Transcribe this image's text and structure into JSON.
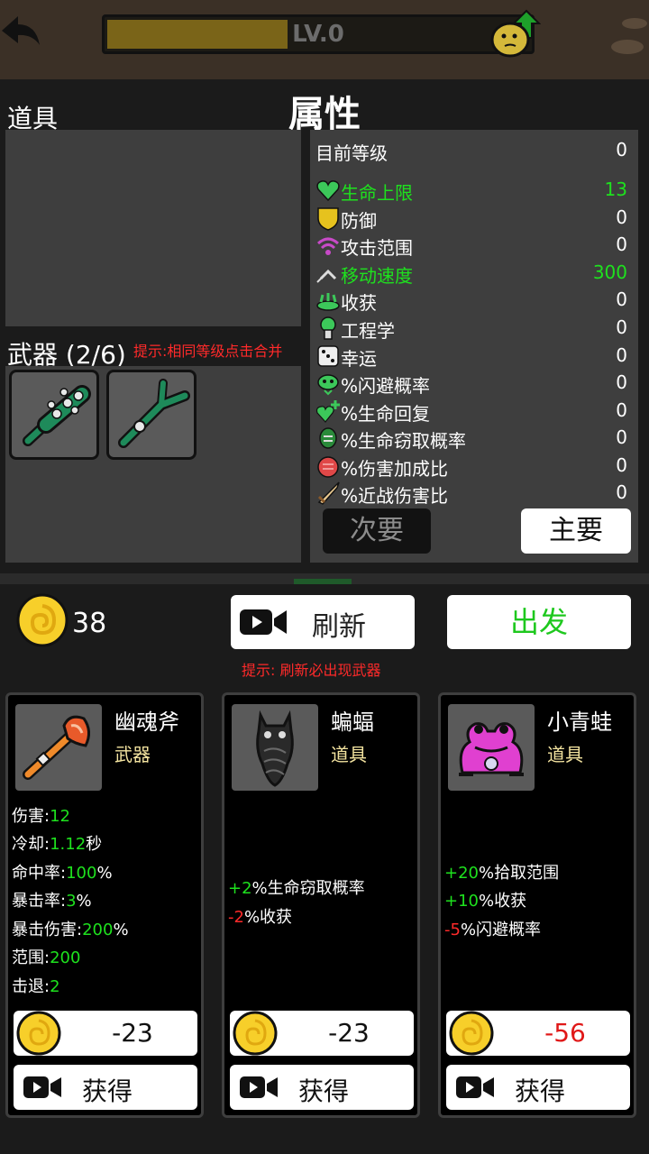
{
  "header": {
    "level_text": "LV.0"
  },
  "attributes": {
    "title": "属性",
    "items_label": "道具",
    "weapons_label": "武器 (2/6)",
    "merge_hint": "提示:相同等级点击合并",
    "stats": [
      {
        "name": "目前等级",
        "value": "0",
        "icon": "none",
        "highlight": false
      },
      {
        "name": "生命上限",
        "value": "13",
        "icon": "heart-icon",
        "highlight": true
      },
      {
        "name": "防御",
        "value": "0",
        "icon": "shield-icon",
        "highlight": false
      },
      {
        "name": "攻击范围",
        "value": "0",
        "icon": "range-icon",
        "highlight": false
      },
      {
        "name": " 移动速度",
        "value": "300",
        "icon": "speed-icon",
        "highlight": true
      },
      {
        "name": "收获",
        "value": "0",
        "icon": "harvest-icon",
        "highlight": false
      },
      {
        "name": "工程学",
        "value": "0",
        "icon": "engineering-icon",
        "highlight": false
      },
      {
        "name": "幸运",
        "value": "0",
        "icon": "dice-icon",
        "highlight": false
      },
      {
        "name": "%闪避概率",
        "value": "0",
        "icon": "dodge-icon",
        "highlight": false
      },
      {
        "name": "%生命回复",
        "value": "0",
        "icon": "regen-icon",
        "highlight": false
      },
      {
        "name": "%生命窃取概率",
        "value": "0",
        "icon": "lifesteal-icon",
        "highlight": false
      },
      {
        "name": "%伤害加成比",
        "value": "0",
        "icon": "damage-icon",
        "highlight": false
      },
      {
        "name": "%近战伤害比",
        "value": "0",
        "icon": "sword-icon",
        "highlight": false
      }
    ],
    "secondary_label": "次要",
    "primary_label": "主要"
  },
  "shop": {
    "coins": "38",
    "refresh_label": "刷新",
    "go_label": "出发",
    "refresh_hint": "提示: 刷新必出现武器",
    "cards": [
      {
        "name": "幽魂斧",
        "type": "武器",
        "lines": [
          {
            "label": "伤害:",
            "value": "12",
            "suffix": ""
          },
          {
            "label": "冷却:",
            "value": "1.12",
            "suffix": "秒"
          },
          {
            "label": "命中率:",
            "value": "100",
            "suffix": "%"
          },
          {
            "label": "暴击率:",
            "value": "3",
            "suffix": "%"
          },
          {
            "label": "暴击伤害:",
            "value": "200",
            "suffix": "%"
          },
          {
            "label": "范围:",
            "value": "200",
            "suffix": ""
          },
          {
            "label": "击退:",
            "value": "2",
            "suffix": ""
          }
        ],
        "price": "-23",
        "price_red": false,
        "buy_label": "获得"
      },
      {
        "name": "蝙蝠",
        "type": "道具",
        "lines": [
          {
            "sign": "+2",
            "text": "%生命窃取概率",
            "positive": true
          },
          {
            "sign": "-2",
            "text": "%收获",
            "positive": false
          }
        ],
        "price": "-23",
        "price_red": false,
        "buy_label": "获得"
      },
      {
        "name": "小青蛙",
        "type": "道具",
        "lines": [
          {
            "sign": "+20",
            "text": "%拾取范围",
            "positive": true
          },
          {
            "sign": "+10",
            "text": "%收获",
            "positive": true
          },
          {
            "sign": "-5",
            "text": "%闪避概率",
            "positive": false
          }
        ],
        "price": "-56",
        "price_red": true,
        "buy_label": "获得"
      }
    ]
  }
}
